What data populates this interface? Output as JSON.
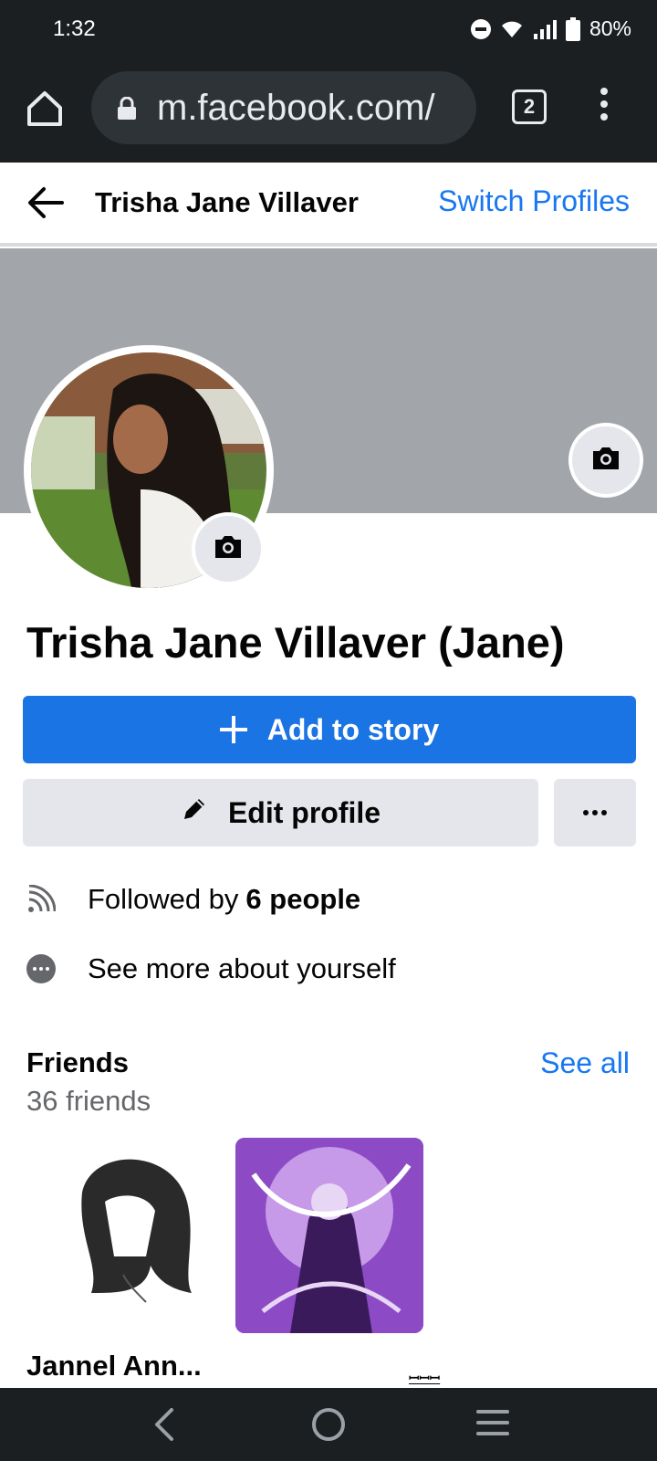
{
  "status_bar": {
    "time": "1:32",
    "battery": "80%",
    "icons": [
      "do-not-disturb-icon",
      "wifi-icon",
      "signal-icon",
      "battery-icon"
    ]
  },
  "browser": {
    "url": "m.facebook.com/",
    "tab_count": "2",
    "icons": [
      "home-icon",
      "lock-icon",
      "tabs-icon",
      "menu-icon"
    ]
  },
  "header": {
    "title": "Trisha Jane Villaver",
    "switch_profiles": "Switch Profiles"
  },
  "profile": {
    "name": "Trisha Jane Villaver (Jane)"
  },
  "actions": {
    "add_story": "Add to story",
    "edit_profile": "Edit profile"
  },
  "info": {
    "followed_prefix": "Followed by",
    "followed_count": "6 people",
    "see_more": "See more about yourself"
  },
  "friends": {
    "title": "Friends",
    "count": "36 friends",
    "see_all": "See all",
    "items": [
      {
        "name": "Jannel Ann..."
      },
      {
        "name": "ꟷꟷꟷ"
      }
    ]
  },
  "colors": {
    "accent": "#1877f2",
    "button_blue": "#1b74e4",
    "button_gray": "#e4e6eb",
    "cover_gray": "#a2a5a9",
    "chrome_dark": "#1c1f22"
  }
}
